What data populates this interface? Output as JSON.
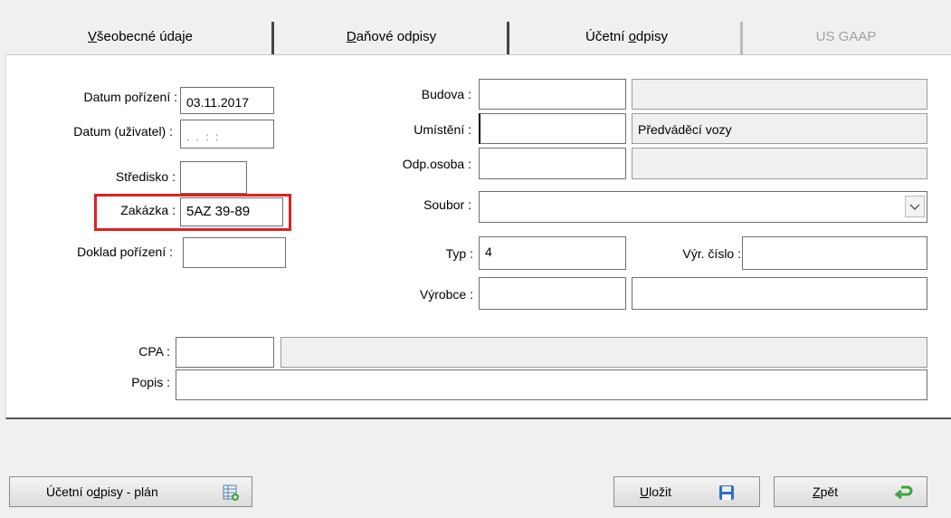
{
  "tabs": [
    {
      "pre": "",
      "u": "V",
      "post": "šeobecné údaje"
    },
    {
      "pre": "",
      "u": "D",
      "post": "aňové odpisy"
    },
    {
      "pre": "Účetní ",
      "u": "o",
      "post": "dpisy"
    },
    {
      "pre": "US GAAP",
      "u": "",
      "post": ""
    }
  ],
  "left": {
    "datum_porizeni_label": "Datum pořízení :",
    "datum_porizeni_value": "03.11.2017",
    "datum_uzivatel_label": "Datum (uživatel) :",
    "datum_uzivatel_value": ". .     : :",
    "stredisko_label": "Středisko :",
    "stredisko_value": "",
    "zakazka_label": "Zakázka :",
    "zakazka_value": "5AZ 39-89",
    "doklad_label": "Doklad pořízení :",
    "doklad_value": ""
  },
  "right": {
    "budova_label": "Budova :",
    "budova_value": "",
    "budova_desc": "",
    "umisteni_label": "Umístění :",
    "umisteni_value": "",
    "umisteni_desc": "Předváděcí vozy",
    "odp_label": "Odp.osoba :",
    "odp_value": "",
    "odp_desc": "",
    "soubor_label": "Soubor :",
    "soubor_value": "",
    "typ_label": "Typ :",
    "typ_value": "4",
    "vyr_cislo_label": "Výr. číslo :",
    "vyr_cislo_value": "",
    "vyrobce_label": "Výrobce :",
    "vyrobce_value": "",
    "vyrobce_desc": ""
  },
  "bottom": {
    "cpa_label": "CPA :",
    "cpa_value": "",
    "cpa_desc": "",
    "popis_label": "Popis :",
    "popis_value": ""
  },
  "buttons": {
    "plan": {
      "pre": "Účetní o",
      "u": "d",
      "post": "pisy - plán",
      "icon": "table-icon"
    },
    "ulozit": {
      "pre": "",
      "u": "U",
      "post": "ložit",
      "icon": "floppy-disk-icon"
    },
    "zpet": {
      "pre": "",
      "u": "Z",
      "post": "pět",
      "icon": "return-arrow-icon"
    }
  },
  "colors": {
    "highlight": "#e02020",
    "accent_green": "#3aa63a",
    "save_blue": "#2f6fc4"
  }
}
